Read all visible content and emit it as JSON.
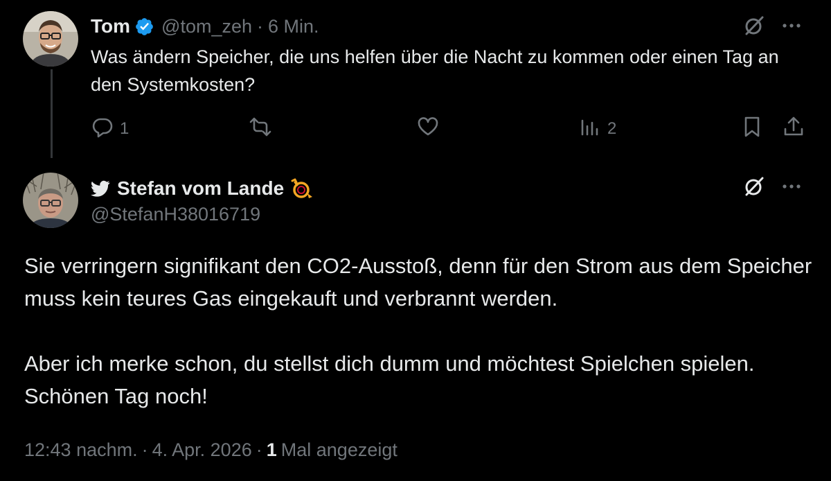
{
  "tweet1": {
    "author_name": "Tom",
    "handle": "@tom_zeh",
    "separator": "·",
    "time": "6 Min.",
    "text": "Was ändern Speicher, die uns helfen über die Nacht zu kommen oder einen Tag an den Systemkosten?",
    "replies": "1",
    "views": "2",
    "icons": {
      "verified": "verified-badge-icon",
      "grok": "grok-icon",
      "more": "more-icon",
      "reply": "reply-icon",
      "retweet": "retweet-icon",
      "like": "like-icon",
      "views": "views-icon",
      "bookmark": "bookmark-icon",
      "share": "share-icon"
    }
  },
  "tweet2": {
    "author_name": "Stefan vom Lande",
    "handle": "@StefanH38016719",
    "paragraphs": [
      "Sie verringern signifikant den CO2-Ausstoß, denn für den Strom aus dem Speicher muss kein teures Gas eingekauft und verbrannt werden.",
      "Aber ich merke schon, du stellst dich dumm und möchtest Spielchen spielen. Schönen Tag noch!"
    ],
    "timestamp": "12:43 nachm.",
    "date": "4. Apr. 2026",
    "view_count": "1",
    "view_label": "Mal angezeigt",
    "separator": "·",
    "icons": {
      "bird": "twitter-bird-icon",
      "emoji": "post-horn-emoji-icon",
      "grok": "grok-icon",
      "more": "more-icon"
    }
  },
  "colors": {
    "background": "#000000",
    "text_primary": "#e7e9ea",
    "text_secondary": "#71767b",
    "verified_blue": "#1d9bf0",
    "thread_line": "#333639",
    "horn_orange": "#f5a623"
  }
}
